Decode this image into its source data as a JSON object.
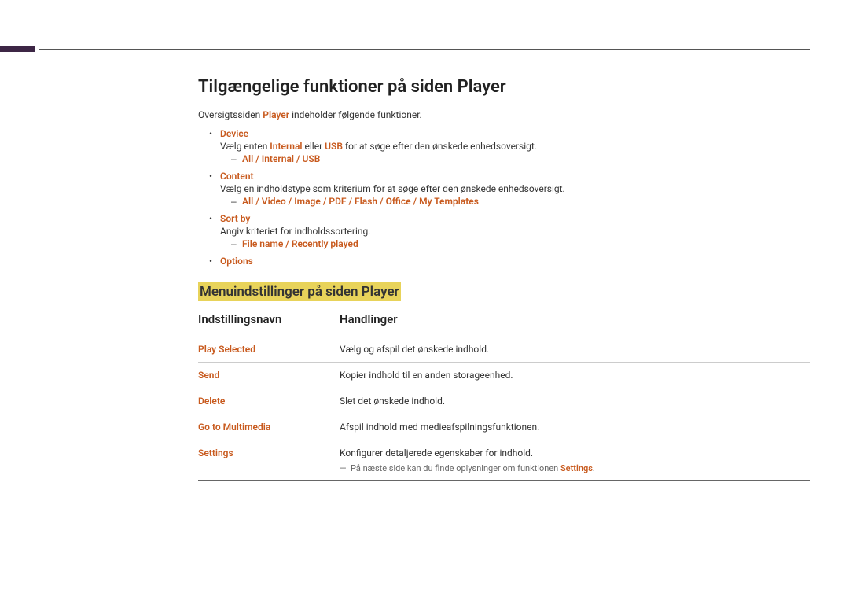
{
  "page": {
    "title": "Tilgængelige funktioner på siden Player",
    "intro_pre": "Oversigtssiden ",
    "intro_bold": "Player",
    "intro_post": " indeholder følgende funktioner."
  },
  "items": [
    {
      "term": "Device",
      "desc_pre": "Vælg enten ",
      "desc_b1": "Internal",
      "desc_mid": " eller ",
      "desc_b2": "USB",
      "desc_post": " for at søge efter den ønskede enhedsoversigt.",
      "sub": [
        "All",
        "Internal",
        "USB"
      ]
    },
    {
      "term": "Content",
      "desc": "Vælg en indholdstype som kriterium for at søge efter den ønskede enhedsoversigt.",
      "sub": [
        "All",
        "Video",
        "Image",
        "PDF",
        "Flash",
        "Office",
        "My Templates"
      ]
    },
    {
      "term": "Sort by",
      "desc": "Angiv kriteriet for indholdssortering.",
      "sub": [
        "File name",
        "Recently played"
      ]
    },
    {
      "term": "Options"
    }
  ],
  "section2": {
    "heading": "Menuindstillinger på siden Player",
    "col1": "Indstillingsnavn",
    "col2": "Handlinger",
    "rows": [
      {
        "name": "Play Selected",
        "action": "Vælg og afspil det ønskede indhold."
      },
      {
        "name": "Send",
        "action": "Kopier indhold til en anden storageenhed."
      },
      {
        "name": "Delete",
        "action": "Slet det ønskede indhold."
      },
      {
        "name": "Go to Multimedia",
        "action": "Afspil indhold med medieafspilningsfunktionen."
      },
      {
        "name": "Settings",
        "action": "Konfigurer detaljerede egenskaber for indhold.",
        "note_pre": "På næste side kan du finde oplysninger om funktionen ",
        "note_bold": "Settings",
        "note_post": "."
      }
    ]
  }
}
